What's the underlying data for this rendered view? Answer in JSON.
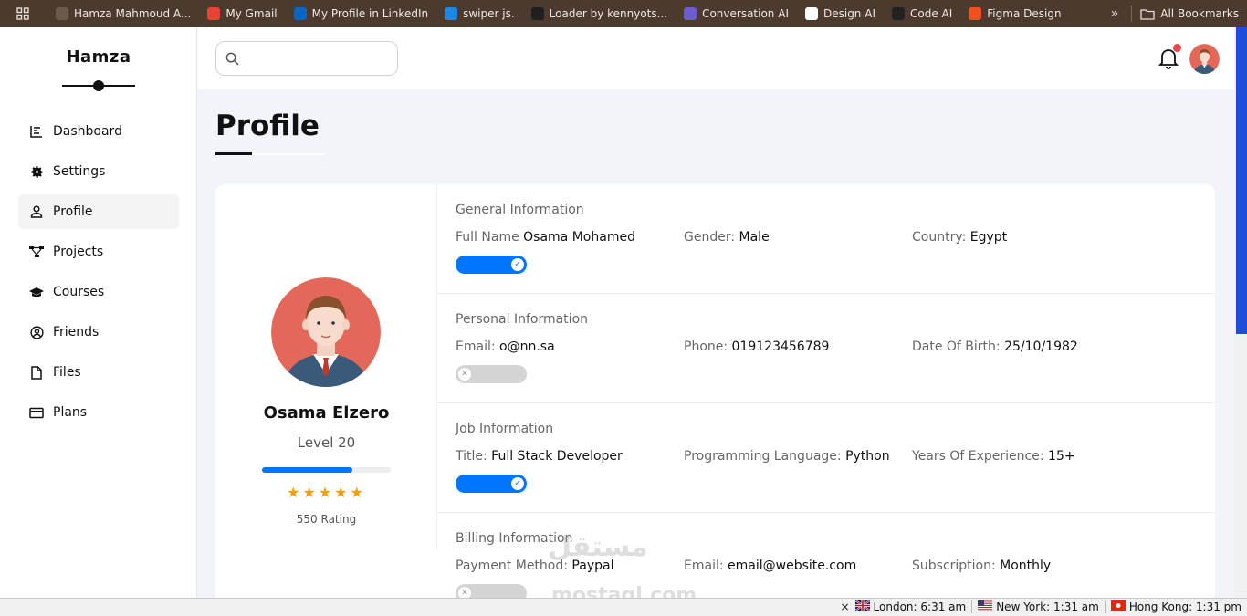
{
  "bookmarks": [
    {
      "label": "Hamza Mahmoud A...",
      "icon": "user-photo-icon",
      "color": "#6b5a4a"
    },
    {
      "label": "My Gmail",
      "icon": "gmail-icon",
      "color": "#ea4335"
    },
    {
      "label": "My Profile in LinkedIn",
      "icon": "linkedin-icon",
      "color": "#0a66c2"
    },
    {
      "label": "swiper js.",
      "icon": "swiper-icon",
      "color": "#1e88e5"
    },
    {
      "label": "Loader by kennyots...",
      "icon": "uiverse-icon",
      "color": "#1f1f1f"
    },
    {
      "label": "Conversation AI",
      "icon": "conversation-ai-icon",
      "color": "#6d5bd0"
    },
    {
      "label": "Design AI",
      "icon": "design-ai-icon",
      "color": "#ffffff"
    },
    {
      "label": "Code AI",
      "icon": "code-ai-icon",
      "color": "#222222"
    },
    {
      "label": "Figma Design",
      "icon": "figma-icon",
      "color": "#f24e1e"
    }
  ],
  "bookmarks_right": {
    "label": "All Bookmarks"
  },
  "sidebar": {
    "brand": "Hamza",
    "items": [
      {
        "label": "Dashboard",
        "icon": "chart-icon"
      },
      {
        "label": "Settings",
        "icon": "gear-icon"
      },
      {
        "label": "Profile",
        "icon": "user-icon",
        "active": true
      },
      {
        "label": "Projects",
        "icon": "diagram-icon"
      },
      {
        "label": "Courses",
        "icon": "graduation-cap-icon"
      },
      {
        "label": "Friends",
        "icon": "user-circle-icon"
      },
      {
        "label": "Files",
        "icon": "file-icon"
      },
      {
        "label": "Plans",
        "icon": "credit-card-icon"
      }
    ]
  },
  "header": {
    "search_value": "",
    "search_placeholder": ""
  },
  "page": {
    "title": "Profile"
  },
  "profile": {
    "name": "Osama Elzero",
    "level": "Level 20",
    "level_progress": 0.7,
    "stars": 5,
    "stars_text": "★★★★★",
    "rating": "550 Rating"
  },
  "sections": [
    {
      "title": "General Information",
      "toggle": "on",
      "fields": [
        {
          "label": "Full Name ",
          "value": "Osama Mohamed"
        },
        {
          "label": "Gender: ",
          "value": "Male"
        },
        {
          "label": "Country: ",
          "value": "Egypt"
        }
      ]
    },
    {
      "title": "Personal Information",
      "toggle": "off",
      "fields": [
        {
          "label": "Email: ",
          "value": "o@nn.sa"
        },
        {
          "label": "Phone: ",
          "value": "019123456789"
        },
        {
          "label": "Date Of Birth: ",
          "value": "25/10/1982"
        }
      ]
    },
    {
      "title": "Job Information",
      "toggle": "on",
      "fields": [
        {
          "label": "Title: ",
          "value": "Full Stack Developer"
        },
        {
          "label": "Programming Language: ",
          "value": "Python"
        },
        {
          "label": "Years Of Experience: ",
          "value": "15+"
        }
      ]
    },
    {
      "title": "Billing Information",
      "toggle": "off",
      "fields": [
        {
          "label": "Payment Method: ",
          "value": "Paypal"
        },
        {
          "label": "Email: ",
          "value": "email@website.com"
        },
        {
          "label": "Subscription: ",
          "value": "Monthly"
        }
      ]
    }
  ],
  "watermark": {
    "line1": "مستقل",
    "line2": "mostaql.com"
  },
  "status_bar": {
    "clocks": [
      {
        "label": "London: 6:31 am",
        "flag": "uk-flag-icon"
      },
      {
        "label": "New York: 1:31 am",
        "flag": "us-flag-icon"
      },
      {
        "label": "Hong Kong: 1:31 pm",
        "flag": "hk-flag-icon"
      }
    ]
  },
  "colors": {
    "accent": "#0075ff",
    "notification": "#ef4444",
    "star": "#f59e0b",
    "bookmark_bar": "#4b3a2d"
  }
}
